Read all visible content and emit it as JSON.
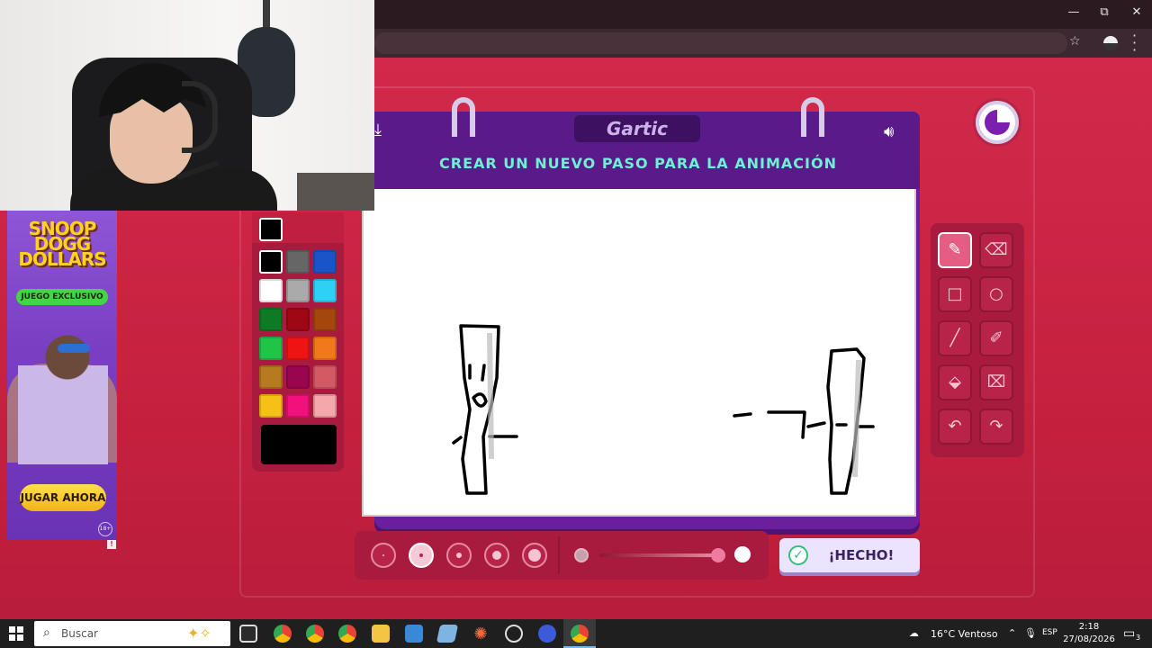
{
  "window": {
    "minimize": "—",
    "restore": "⧉",
    "close": "✕"
  },
  "ad": {
    "title": "SNOOP DOGG DOLLARS",
    "tagline": "JUEGO EXCLUSIVO",
    "cta": "JUGAR AHORA",
    "age": "18+"
  },
  "game": {
    "logo": "Gartic",
    "instruction": "CREAR UN NUEVO PASO PARA LA ANIMACIÓN",
    "done_label": "¡HECHO!"
  },
  "palette": {
    "current": "#000000",
    "colors": [
      "#000000",
      "#666666",
      "#1a55c8",
      "#ffffff",
      "#aaaaaa",
      "#2ed0f5",
      "#0f7a24",
      "#9e0713",
      "#a3470f",
      "#20c548",
      "#ef1313",
      "#f07a1a",
      "#b77a1e",
      "#99054e",
      "#d35a64",
      "#f5c116",
      "#f0117d",
      "#f5a8ab"
    ]
  },
  "tools": [
    {
      "name": "pencil-icon",
      "glyph": "✎",
      "active": true
    },
    {
      "name": "eraser-icon",
      "glyph": "⌫",
      "active": false
    },
    {
      "name": "rectangle-icon",
      "glyph": "□",
      "active": false
    },
    {
      "name": "ellipse-icon",
      "glyph": "○",
      "active": false
    },
    {
      "name": "line-icon",
      "glyph": "╱",
      "active": false
    },
    {
      "name": "eyedropper-icon",
      "glyph": "✐",
      "active": false
    },
    {
      "name": "fill-icon",
      "glyph": "⬙",
      "active": false
    },
    {
      "name": "clear-icon",
      "glyph": "⌧",
      "active": false
    },
    {
      "name": "undo-icon",
      "glyph": "↶",
      "active": false
    },
    {
      "name": "redo-icon",
      "glyph": "↷",
      "active": false
    }
  ],
  "taskbar": {
    "search_placeholder": "Buscar",
    "weather": "16°C  Ventoso",
    "language": "ESP",
    "time": "2:18",
    "date": "27/08/2026",
    "notifications": "3"
  }
}
